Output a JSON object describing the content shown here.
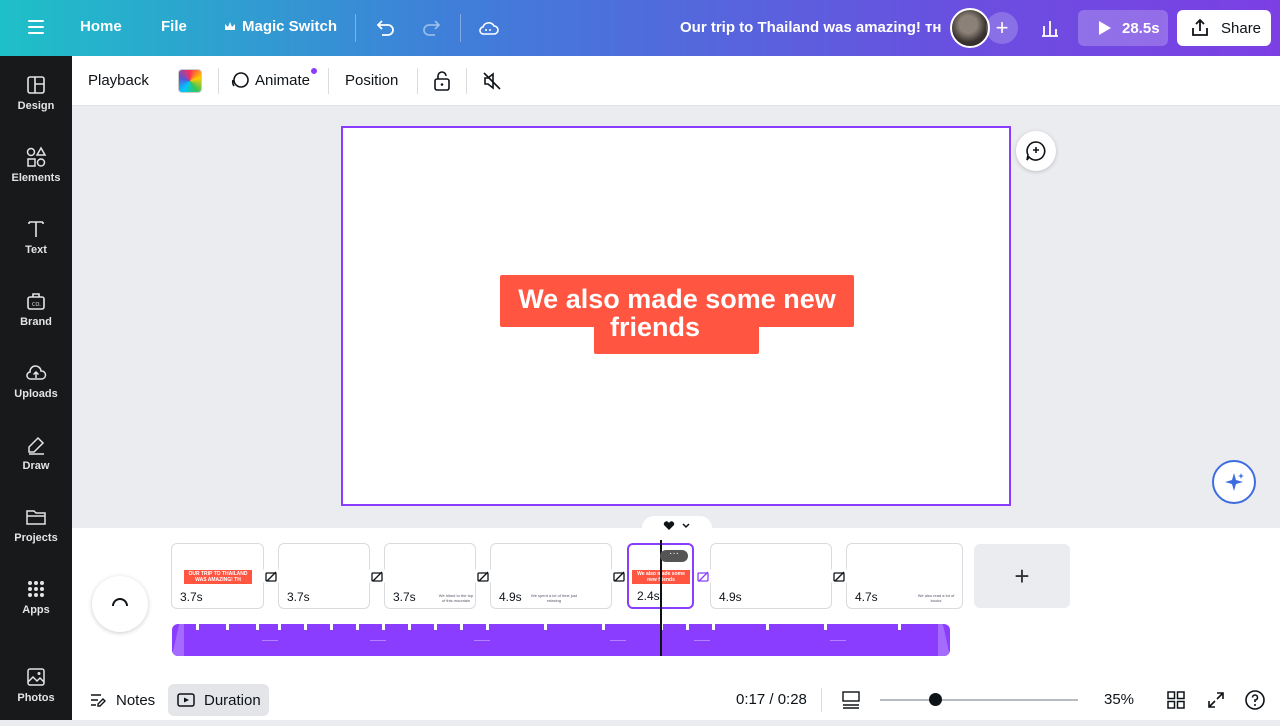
{
  "topbar": {
    "home": "Home",
    "file": "File",
    "magic_switch": "Magic Switch",
    "doc_title": "Our trip to Thailand was amazing! ᴛʜ",
    "play_duration": "28.5s",
    "share": "Share",
    "add_collaborator": "+"
  },
  "sidebar": {
    "items": [
      {
        "label": "Design",
        "icon": "design-icon"
      },
      {
        "label": "Elements",
        "icon": "elements-icon"
      },
      {
        "label": "Text",
        "icon": "text-icon"
      },
      {
        "label": "Brand",
        "icon": "brand-icon"
      },
      {
        "label": "Uploads",
        "icon": "uploads-icon"
      },
      {
        "label": "Draw",
        "icon": "draw-icon"
      },
      {
        "label": "Projects",
        "icon": "projects-icon"
      },
      {
        "label": "Apps",
        "icon": "apps-icon"
      },
      {
        "label": "Photos",
        "icon": "photos-icon"
      }
    ]
  },
  "toolbar": {
    "playback": "Playback",
    "animate": "Animate",
    "position": "Position"
  },
  "canvas": {
    "headline_line1": "We also made some new",
    "headline_line2": "friends",
    "accent_color": "#ff5541",
    "selection_color": "#8b3dff"
  },
  "timeline": {
    "scenes": [
      {
        "duration": "3.7s",
        "thumb": "OUR TRIP TO THAILAND WAS AMAZING! TH"
      },
      {
        "duration": "3.7s",
        "thumb": ""
      },
      {
        "duration": "3.7s",
        "thumb": "We hiked to the top of this mountain"
      },
      {
        "duration": "4.9s",
        "thumb": "We spent a lot of time just relaxing"
      },
      {
        "duration": "2.4s",
        "thumb": "We also made some new friends"
      },
      {
        "duration": "4.9s",
        "thumb": ""
      },
      {
        "duration": "4.7s",
        "thumb": "We also read a lot of books"
      }
    ],
    "add_scene": "+",
    "more": "···"
  },
  "bottombar": {
    "notes": "Notes",
    "duration": "Duration",
    "time": "0:17 / 0:28",
    "zoom": "35%",
    "zoom_level": 0.28
  }
}
